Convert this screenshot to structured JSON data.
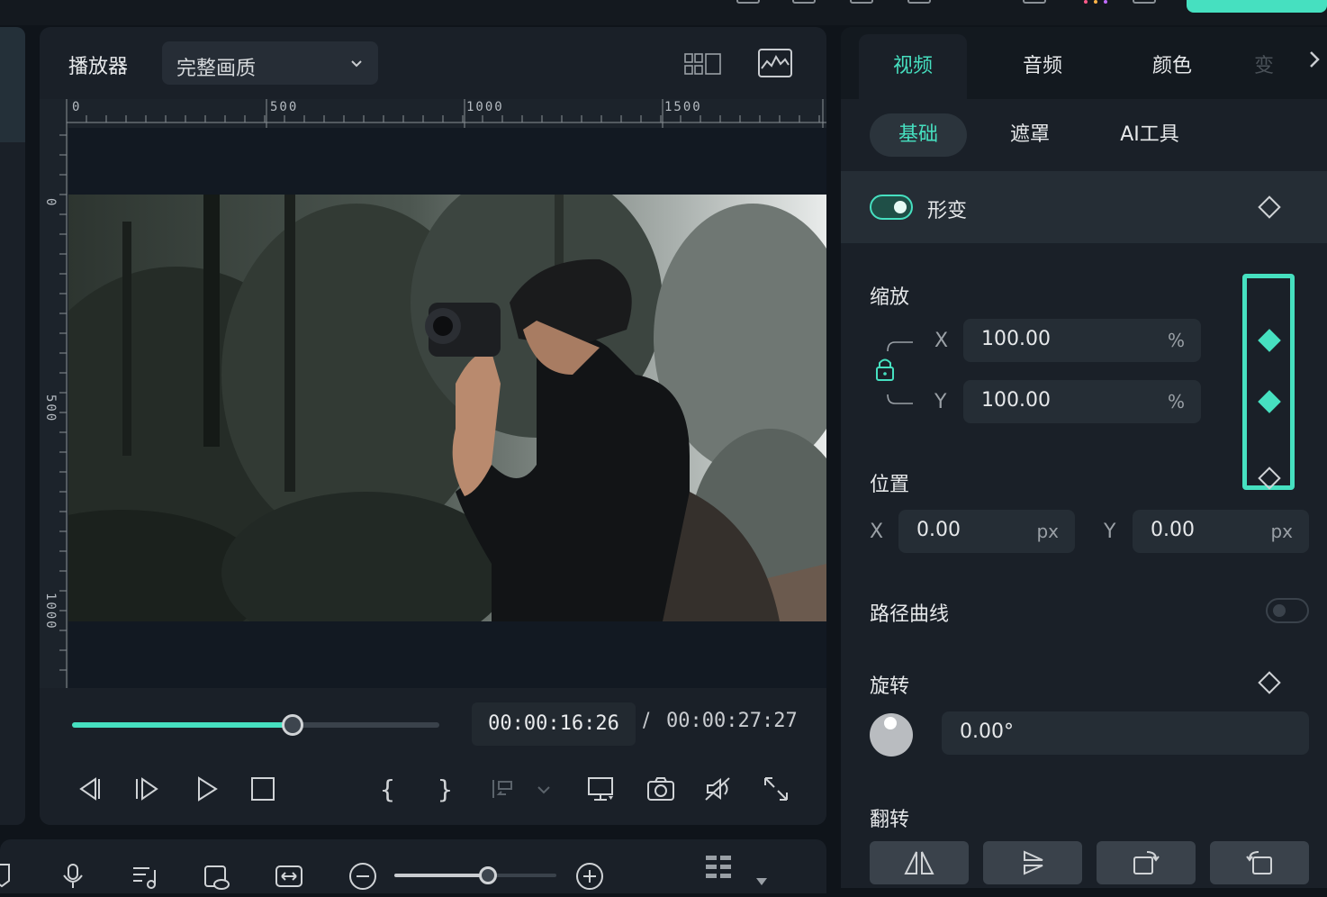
{
  "player": {
    "title": "播放器",
    "quality": "完整画质",
    "ruler_top": [
      "0",
      "500",
      "1000",
      "1500"
    ],
    "ruler_left": [
      "0",
      "500",
      "1000"
    ],
    "current_time": "00:00:16:26",
    "separator": "/",
    "total_time": "00:00:27:27",
    "progress_percent": 60
  },
  "inspector": {
    "tabs": [
      "视频",
      "音频",
      "颜色",
      "变"
    ],
    "subtabs": [
      "基础",
      "遮罩",
      "AI工具"
    ],
    "transform_label": "形变",
    "scale": {
      "label": "缩放",
      "x_axis": "X",
      "x_value": "100.00",
      "x_unit": "%",
      "y_axis": "Y",
      "y_value": "100.00",
      "y_unit": "%"
    },
    "position": {
      "label": "位置",
      "x_axis": "X",
      "x_value": "0.00",
      "x_unit": "px",
      "y_axis": "Y",
      "y_value": "0.00",
      "y_unit": "px"
    },
    "path_curve_label": "路径曲线",
    "rotation": {
      "label": "旋转",
      "value": "0.00°"
    },
    "flip_label": "翻转"
  },
  "colors": {
    "accent": "#46e0c0",
    "panel": "#1a2028",
    "bg": "#0f141a"
  },
  "zoom_percent": 58
}
